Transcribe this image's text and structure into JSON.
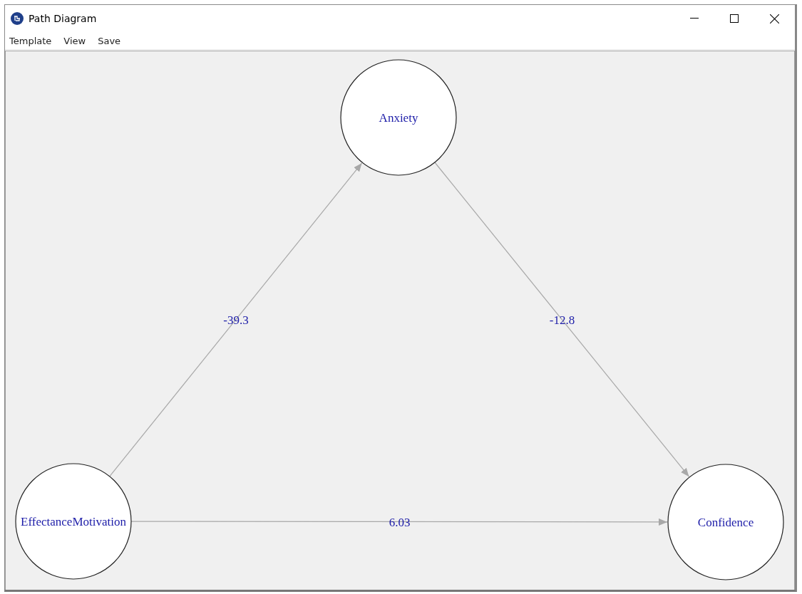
{
  "window": {
    "title": "Path Diagram"
  },
  "menu": [
    {
      "label": "Template"
    },
    {
      "label": "View"
    },
    {
      "label": "Save"
    }
  ],
  "diagram": {
    "nodes": [
      {
        "label": "Anxiety"
      },
      {
        "label": "EffectanceMotivation"
      },
      {
        "label": "Confidence"
      }
    ],
    "edges": [
      {
        "label": "-39.3"
      },
      {
        "label": "-12.8"
      },
      {
        "label": "6.03"
      }
    ]
  }
}
